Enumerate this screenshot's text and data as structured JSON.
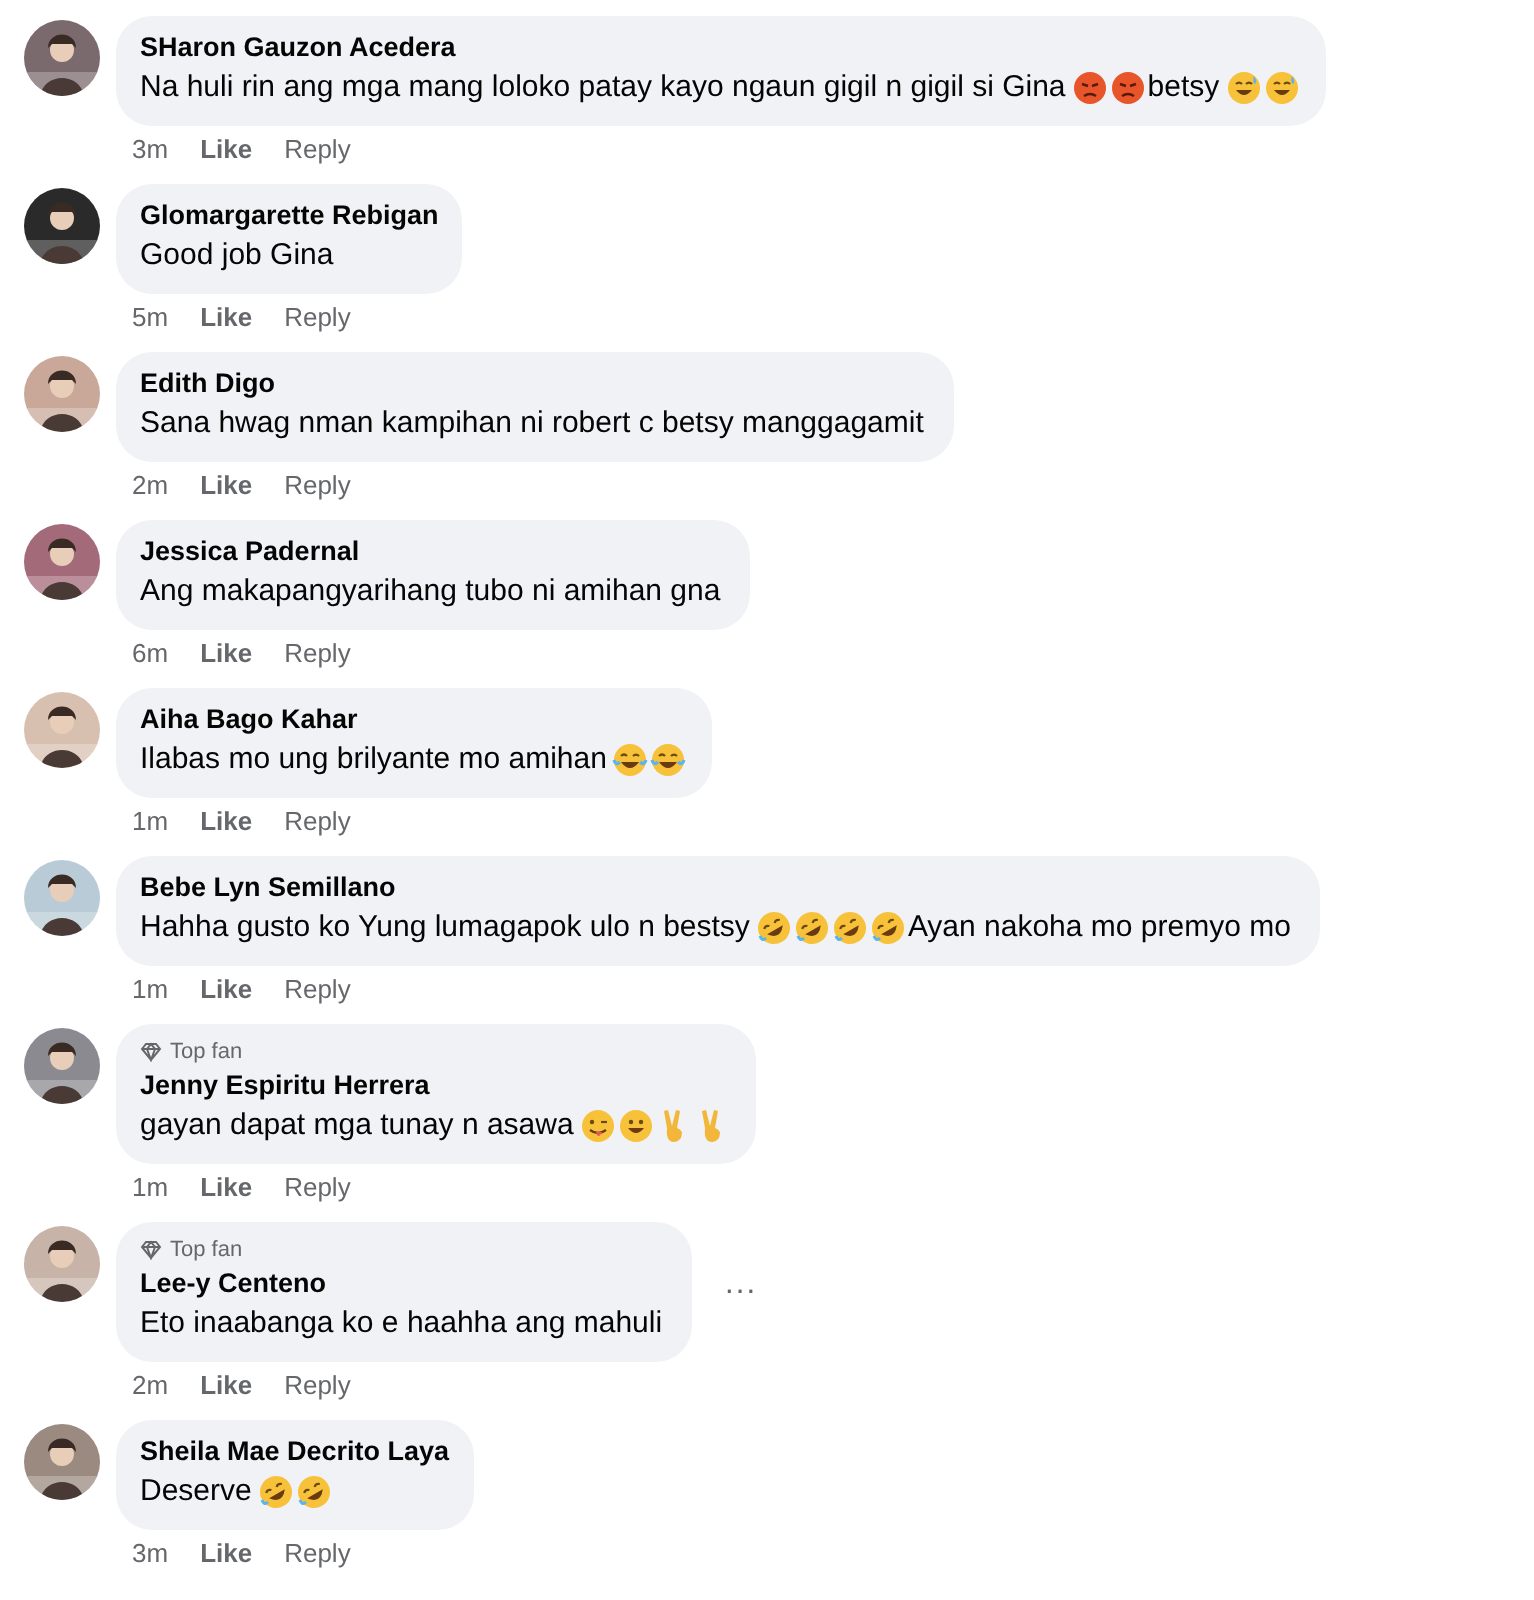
{
  "comments": [
    {
      "author": "SHaron Gauzon Acedera",
      "body": [
        {
          "kind": "text",
          "text": "Na huli rin ang mga mang loloko patay kayo ngaun gigil n gigil si Gina"
        },
        {
          "kind": "angry"
        },
        {
          "kind": "angry"
        },
        {
          "kind": "text",
          "text": "betsy"
        },
        {
          "kind": "sweatsmile"
        },
        {
          "kind": "sweatsmile"
        }
      ],
      "time": "3m",
      "like": "Like",
      "reply": "Reply"
    },
    {
      "author": "Glomargarette Rebigan",
      "body": [
        {
          "kind": "text",
          "text": "Good job Gina"
        }
      ],
      "time": "5m",
      "like": "Like",
      "reply": "Reply"
    },
    {
      "author": "Edith Digo",
      "body": [
        {
          "kind": "text",
          "text": "Sana hwag nman kampihan ni robert c betsy manggagamit"
        }
      ],
      "time": "2m",
      "like": "Like",
      "reply": "Reply"
    },
    {
      "author": "Jessica Padernal",
      "body": [
        {
          "kind": "text",
          "text": "Ang makapangyarihang tubo ni amihan gna"
        }
      ],
      "time": "6m",
      "like": "Like",
      "reply": "Reply"
    },
    {
      "author": "Aiha Bago Kahar",
      "body": [
        {
          "kind": "text",
          "text": "Ilabas mo ung brilyante mo amihan"
        },
        {
          "kind": "joy"
        },
        {
          "kind": "joy"
        }
      ],
      "time": "1m",
      "like": "Like",
      "reply": "Reply"
    },
    {
      "author": "Bebe Lyn Semillano",
      "body": [
        {
          "kind": "text",
          "text": "Hahha gusto ko Yung lumagapok ulo n bestsy"
        },
        {
          "kind": "rofl"
        },
        {
          "kind": "rofl"
        },
        {
          "kind": "rofl"
        },
        {
          "kind": "rofl"
        },
        {
          "kind": "text",
          "text": "Ayan nakoha mo premyo mo"
        }
      ],
      "time": "1m",
      "like": "Like",
      "reply": "Reply"
    },
    {
      "author": "Jenny Espiritu Herrera",
      "badge": "Top fan",
      "body": [
        {
          "kind": "text",
          "text": "gayan dapat mga tunay n asawa"
        },
        {
          "kind": "wink"
        },
        {
          "kind": "grin"
        },
        {
          "kind": "peace"
        },
        {
          "kind": "peace"
        }
      ],
      "time": "1m",
      "like": "Like",
      "reply": "Reply"
    },
    {
      "author": "Lee-y Centeno",
      "badge": "Top fan",
      "body": [
        {
          "kind": "text",
          "text": "Eto inaabanga ko e haahha ang mahuli"
        }
      ],
      "time": "2m",
      "like": "Like",
      "reply": "Reply",
      "more": "···"
    },
    {
      "author": "Sheila Mae Decrito Laya",
      "body": [
        {
          "kind": "text",
          "text": "Deserve"
        },
        {
          "kind": "rofl"
        },
        {
          "kind": "rofl"
        }
      ],
      "time": "3m",
      "like": "Like",
      "reply": "Reply"
    }
  ]
}
